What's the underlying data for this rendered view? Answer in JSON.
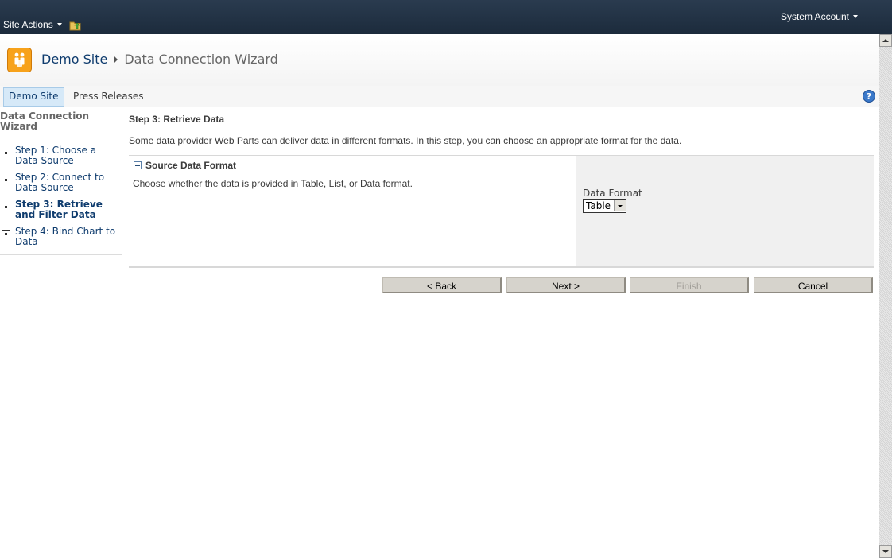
{
  "topbar": {
    "site_actions_label": "Site Actions",
    "user_label": "System Account"
  },
  "title_area": {
    "site_name": "Demo Site",
    "page_title": "Data Connection Wizard"
  },
  "top_nav": {
    "tabs": [
      {
        "label": "Demo Site",
        "selected": true
      },
      {
        "label": "Press Releases",
        "selected": false
      }
    ]
  },
  "left_nav": {
    "title": "Data Connection Wizard",
    "steps": [
      {
        "label": "Step 1: Choose a Data Source",
        "current": false
      },
      {
        "label": "Step 2: Connect to Data Source",
        "current": false
      },
      {
        "label": "Step 3: Retrieve and Filter Data",
        "current": true
      },
      {
        "label": "Step 4: Bind Chart to Data",
        "current": false
      }
    ]
  },
  "main": {
    "heading": "Step 3: Retrieve Data",
    "description": "Some data provider Web Parts can deliver data in different formats. In this step, you can choose an appropriate format for the data.",
    "section": {
      "title": "Source Data Format",
      "description": "Choose whether the data is provided in Table, List, or Data format.",
      "field_label": "Data Format",
      "field_value": "Table"
    },
    "buttons": {
      "back": "< Back",
      "next": "Next >",
      "finish": "Finish",
      "cancel": "Cancel"
    }
  },
  "colors": {
    "topbar": "#1c2b3c",
    "link": "#0f3c6e",
    "selected_tab": "#d6e9f8",
    "panel_gray": "#f0f0f0",
    "button_face": "#d6d3cc",
    "logo_orange": "#f7a21b",
    "help_blue": "#3a78c9"
  },
  "icons": {
    "site_actions_caret": "caret-down-icon",
    "folder": "folder-up-icon",
    "logo": "sharepoint-site-logo-icon",
    "help": "help-icon",
    "step": "step-bullet-icon",
    "collapse": "collapse-minus-icon"
  }
}
